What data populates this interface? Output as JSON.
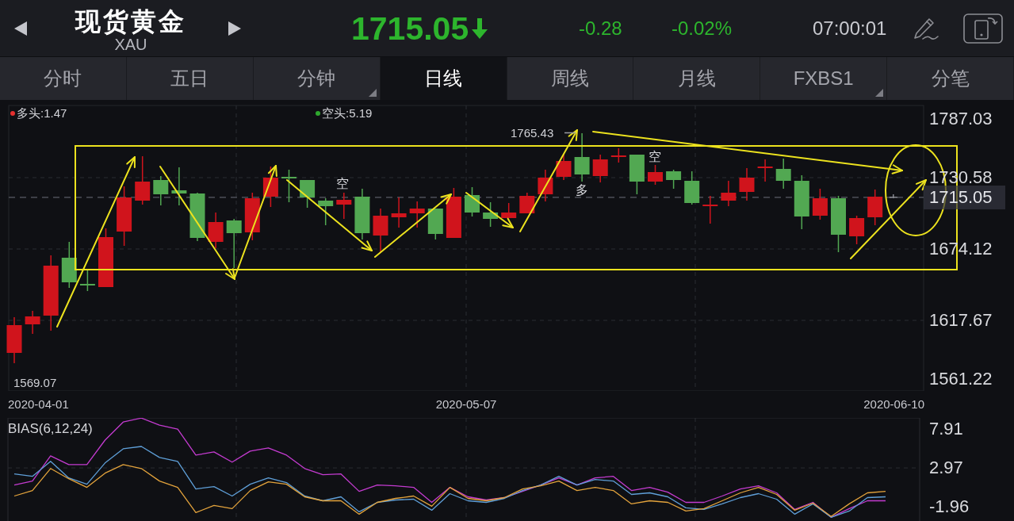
{
  "header": {
    "title": "现货黄金",
    "symbol": "XAU",
    "price": "1715.05",
    "falling": true,
    "change": "-0.28",
    "change_percent": "-0.02%",
    "time": "07:00:01"
  },
  "tabs": [
    {
      "label": "分时",
      "selected": false,
      "has_menu": false
    },
    {
      "label": "五日",
      "selected": false,
      "has_menu": false
    },
    {
      "label": "分钟",
      "selected": false,
      "has_menu": true
    },
    {
      "label": "日线",
      "selected": true,
      "has_menu": false
    },
    {
      "label": "周线",
      "selected": false,
      "has_menu": false
    },
    {
      "label": "月线",
      "selected": false,
      "has_menu": false
    },
    {
      "label": "FXBS1",
      "selected": false,
      "has_menu": true
    },
    {
      "label": "分笔",
      "selected": false,
      "has_menu": false
    }
  ],
  "price_chart": {
    "legend": [
      {
        "label": "多头:1.47",
        "color": "#e5302f"
      },
      {
        "label": "空头:5.19",
        "color": "#2ea82e"
      }
    ],
    "high_label": "1765.43",
    "low_label": "1569.07",
    "annotations": [
      {
        "text": "空"
      },
      {
        "text": "多"
      },
      {
        "text": "空"
      }
    ],
    "y_axis": [
      {
        "label": "1787.03",
        "kind": "tick"
      },
      {
        "label": "1730.58",
        "kind": "tick"
      },
      {
        "label": "1715.05",
        "kind": "current"
      },
      {
        "label": "1674.12",
        "kind": "tick"
      },
      {
        "label": "1617.67",
        "kind": "tick"
      },
      {
        "label": "1561.22",
        "kind": "tick"
      }
    ],
    "dates": [
      "2020-04-01",
      "2020-05-07",
      "2020-06-10"
    ]
  },
  "bias": {
    "chart_data": {
      "type": "line",
      "title": "BIAS(6,12,24)",
      "ylim": [
        -3.77,
        9.32
      ],
      "yticks": [
        7.91,
        2.97,
        -1.96
      ],
      "series": [
        {
          "color": "#c43bd0",
          "values": [
            0.8,
            1.3,
            4.5,
            3.4,
            3.4,
            6.5,
            8.8,
            9.3,
            8.4,
            7.9,
            4.6,
            5,
            3.7,
            5.1,
            5.5,
            4.6,
            2.9,
            2.1,
            2.2,
            0,
            0.8,
            0.7,
            0.5,
            -1.4,
            0.5,
            -0.7,
            -1.1,
            -0.8,
            0,
            0.8,
            1.7,
            0.8,
            1.7,
            1.9,
            0.1,
            0.5,
            -0.1,
            -1.4,
            -1.4,
            -0.6,
            0.3,
            0.7,
            -0.2,
            -2.3,
            -1.4,
            -3.3,
            -2.2,
            -1.2,
            -1.2
          ]
        },
        {
          "color": "#5f9fd8",
          "values": [
            2.2,
            1.9,
            3.8,
            1.7,
            0.9,
            3.6,
            5.4,
            5.7,
            4.3,
            3.8,
            0.3,
            0.6,
            -0.6,
            0.9,
            1.7,
            1.1,
            -0.6,
            -1.2,
            -0.7,
            -2.6,
            -1.4,
            -1.1,
            -1,
            -2.4,
            -0.3,
            -1.2,
            -1.4,
            -0.9,
            0.1,
            0.8,
            1.9,
            0.8,
            1.5,
            1.3,
            -0.4,
            -0.2,
            -0.7,
            -2.1,
            -2.3,
            -1.6,
            -0.8,
            -0.3,
            -1,
            -2.9,
            -1.6,
            -3.3,
            -2.5,
            -0.8,
            -0.7
          ]
        },
        {
          "color": "#e3a33c",
          "values": [
            -0.6,
            0.1,
            2.9,
            1.6,
            0.5,
            2.3,
            3.4,
            2.9,
            1.3,
            0.5,
            -2.7,
            -1.8,
            -2.2,
            0.1,
            1.2,
            0.9,
            -0.7,
            -1.2,
            -1.2,
            -2.9,
            -1.4,
            -0.9,
            -0.6,
            -1.9,
            0.5,
            -0.9,
            -1.2,
            -0.8,
            0.3,
            0.7,
            1.3,
            0.1,
            0.5,
            0.1,
            -1.6,
            -1.2,
            -1.4,
            -2.5,
            -2.2,
            -1.2,
            -0.2,
            0.5,
            -0.4,
            -2.4,
            -1.5,
            -3.2,
            -1.6,
            -0.2,
            0
          ]
        }
      ]
    }
  }
}
